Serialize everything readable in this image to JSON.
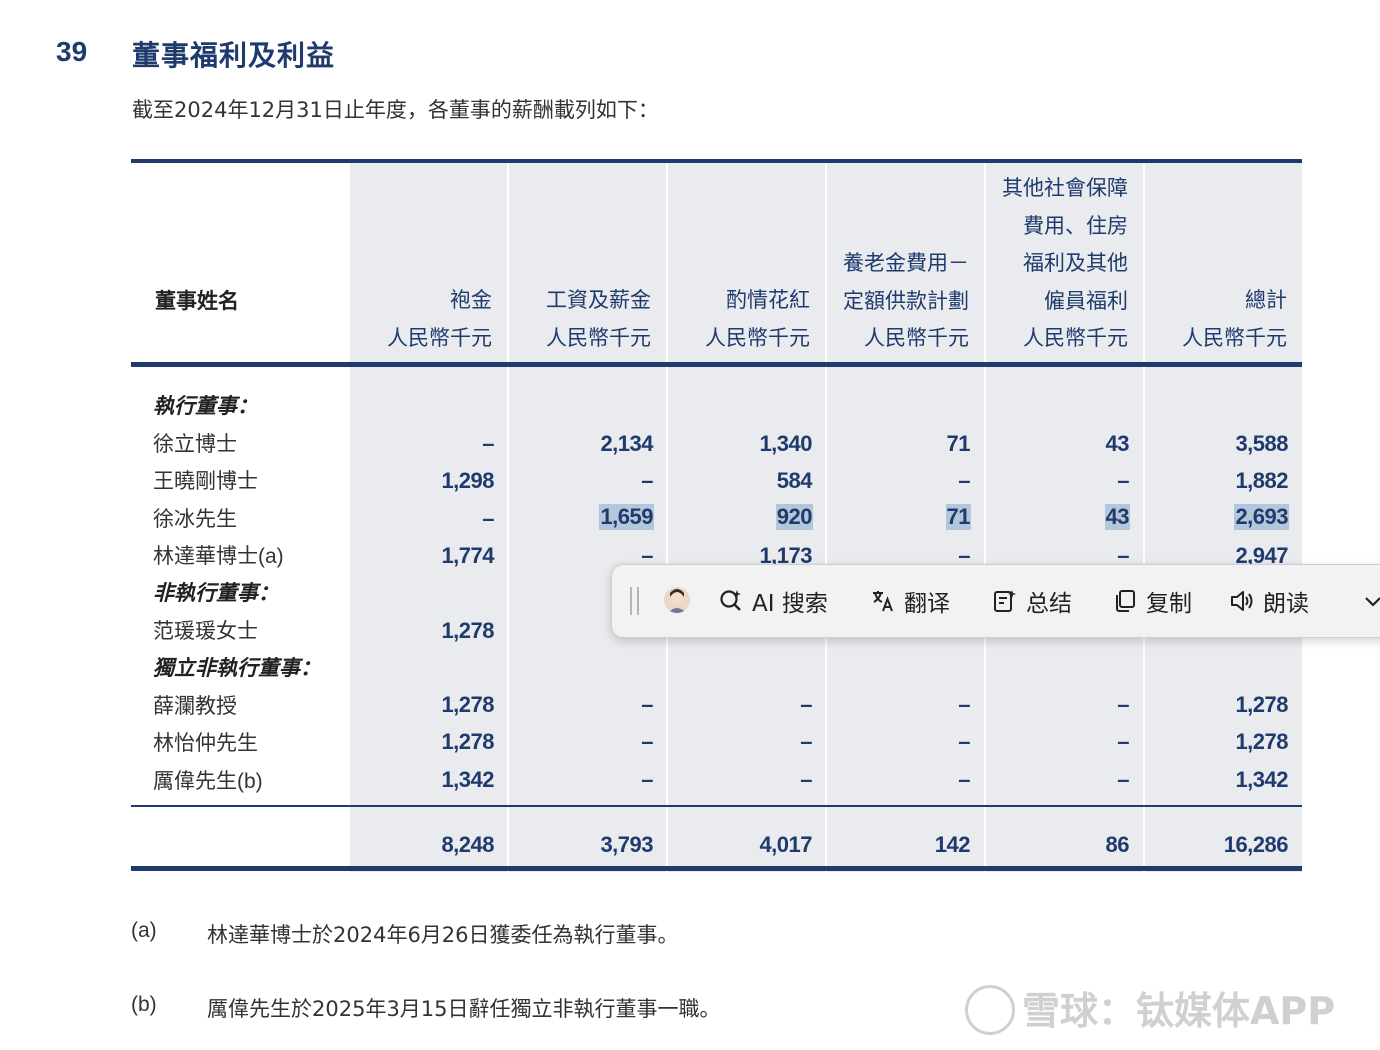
{
  "section": {
    "number": "39",
    "title": "董事福利及利益"
  },
  "intro": "截至2024年12月31日止年度，各董事的薪酬載列如下：",
  "table": {
    "name_header": "董事姓名",
    "columns": [
      {
        "lines": [
          "袍金"
        ],
        "unit": "人民幣千元"
      },
      {
        "lines": [
          "工資及薪金"
        ],
        "unit": "人民幣千元"
      },
      {
        "lines": [
          "酌情花紅"
        ],
        "unit": "人民幣千元"
      },
      {
        "lines": [
          "養老金費用－",
          "定額供款計劃"
        ],
        "unit": "人民幣千元"
      },
      {
        "lines": [
          "其他社會保障",
          "費用、住房",
          "福利及其他",
          "僱員福利"
        ],
        "unit": "人民幣千元"
      },
      {
        "lines": [
          "總計"
        ],
        "unit": "人民幣千元"
      }
    ],
    "groups": [
      {
        "label": "執行董事："
      },
      {
        "label": "非執行董事："
      },
      {
        "label": "獨立非執行董事："
      }
    ],
    "rows": [
      {
        "name": "徐立博士",
        "suffix": "",
        "values": [
          "–",
          "2,134",
          "1,340",
          "71",
          "43",
          "3,588"
        ]
      },
      {
        "name": "王曉剛博士",
        "suffix": "",
        "values": [
          "1,298",
          "–",
          "584",
          "–",
          "–",
          "1,882"
        ]
      },
      {
        "name": "徐冰先生",
        "suffix": "",
        "values": [
          "–",
          "1,659",
          "920",
          "71",
          "43",
          "2,693"
        ]
      },
      {
        "name": "林達華博士",
        "suffix": "(a)",
        "values": [
          "1,774",
          "–",
          "1,173",
          "–",
          "–",
          "2,947"
        ]
      },
      {
        "name": "范瑗瑗女士",
        "suffix": "",
        "values": [
          "1,278",
          "",
          "",
          "",
          "",
          ""
        ]
      },
      {
        "name": "薛瀾教授",
        "suffix": "",
        "values": [
          "1,278",
          "–",
          "–",
          "–",
          "–",
          "1,278"
        ]
      },
      {
        "name": "林怡仲先生",
        "suffix": "",
        "values": [
          "1,278",
          "–",
          "–",
          "–",
          "–",
          "1,278"
        ]
      },
      {
        "name": "厲偉先生",
        "suffix": "(b)",
        "values": [
          "1,342",
          "–",
          "–",
          "–",
          "–",
          "1,342"
        ]
      }
    ],
    "totals": [
      "8,248",
      "3,793",
      "4,017",
      "142",
      "86",
      "16,286"
    ]
  },
  "toolbar": {
    "ai_search": "AI 搜索",
    "translate": "翻译",
    "summary": "总结",
    "copy": "复制",
    "read_aloud": "朗读"
  },
  "notes": [
    {
      "tag": "(a)",
      "text": "林達華博士於2024年6月26日獲委任為執行董事。"
    },
    {
      "tag": "(b)",
      "text": "厲偉先生於2025年3月15日辭任獨立非執行董事一職。"
    }
  ],
  "watermark": "雪球：钛媒体APP",
  "colors": {
    "accent": "#1f3b6e",
    "shade": "#e9ebee",
    "highlight": "#b4c6da"
  }
}
